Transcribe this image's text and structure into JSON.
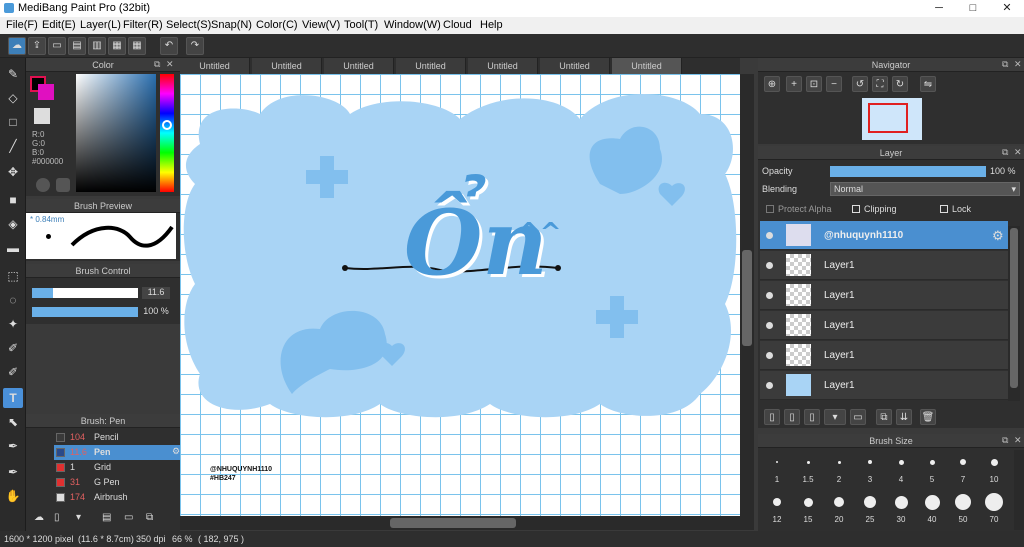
{
  "window": {
    "title": "MediBang Paint Pro (32bit)",
    "minimize": "─",
    "maximize": "□",
    "close": "✕"
  },
  "menu": [
    "File(F)",
    "Edit(E)",
    "Layer(L)",
    "Filter(R)",
    "Select(S)",
    "Snap(N)",
    "Color(C)",
    "View(V)",
    "Tool(T)",
    "Window(W)",
    "Cloud",
    "Help"
  ],
  "tabs": [
    "Untitled",
    "Untitled",
    "Untitled",
    "Untitled",
    "Untitled",
    "Untitled",
    "Untitled"
  ],
  "color_panel": {
    "title": "Color",
    "r": "R:0",
    "g": "G:0",
    "b": "B:0",
    "hex": "#000000"
  },
  "brush_preview": {
    "title": "Brush Preview",
    "size": "* 0.84mm"
  },
  "brush_control": {
    "title": "Brush Control",
    "size_value": "11.6",
    "opacity_value": "100 %",
    "size_fraction": 0.2,
    "opacity_fraction": 1.0
  },
  "brush_list": {
    "title": "Brush: Pen",
    "items": [
      {
        "size": "104",
        "name": "Pencil",
        "color": "#3a3a3a"
      },
      {
        "size": "11.6",
        "name": "Pen",
        "color": "#2a4a8a",
        "selected": true
      },
      {
        "size": "1",
        "name": "Grid",
        "color": "#e03030"
      },
      {
        "size": "31",
        "name": "G Pen",
        "color": "#e03030"
      },
      {
        "size": "174",
        "name": "Airbrush",
        "color": "#dddddd"
      }
    ]
  },
  "canvas": {
    "watermark1": "@NHUQUYNH1110",
    "watermark2": "#HB247",
    "text": "Ổn",
    "caret": "^^"
  },
  "navigator": {
    "title": "Navigator"
  },
  "layer_panel": {
    "title": "Layer",
    "opacity_label": "Opacity",
    "opacity_value": "100 %",
    "opacity_fraction": 1.0,
    "blending_label": "Blending",
    "blending_value": "Normal",
    "protect_alpha": "Protect Alpha",
    "clipping": "Clipping",
    "lock": "Lock",
    "layers": [
      {
        "name": "@nhuquynh1110",
        "selected": true
      },
      {
        "name": "Layer1"
      },
      {
        "name": "Layer1"
      },
      {
        "name": "Layer1"
      },
      {
        "name": "Layer1"
      },
      {
        "name": "Layer1"
      }
    ]
  },
  "brush_size": {
    "title": "Brush Size",
    "sizes": [
      "1",
      "1.5",
      "2",
      "3",
      "4",
      "5",
      "7",
      "10",
      "12",
      "15",
      "20",
      "25",
      "30",
      "40",
      "50",
      "70"
    ]
  },
  "status": {
    "dims": "1600 * 1200 pixel",
    "physical": "(11.6 * 8.7cm)",
    "dpi": "350 dpi",
    "zoom": "66 %",
    "coords": "( 182, 975 )"
  },
  "colors": {
    "accent": "#4a90d9",
    "canvas_bg": "#ffffff",
    "grid": "#7ac3ec",
    "cloud": "#a9d4f5"
  }
}
